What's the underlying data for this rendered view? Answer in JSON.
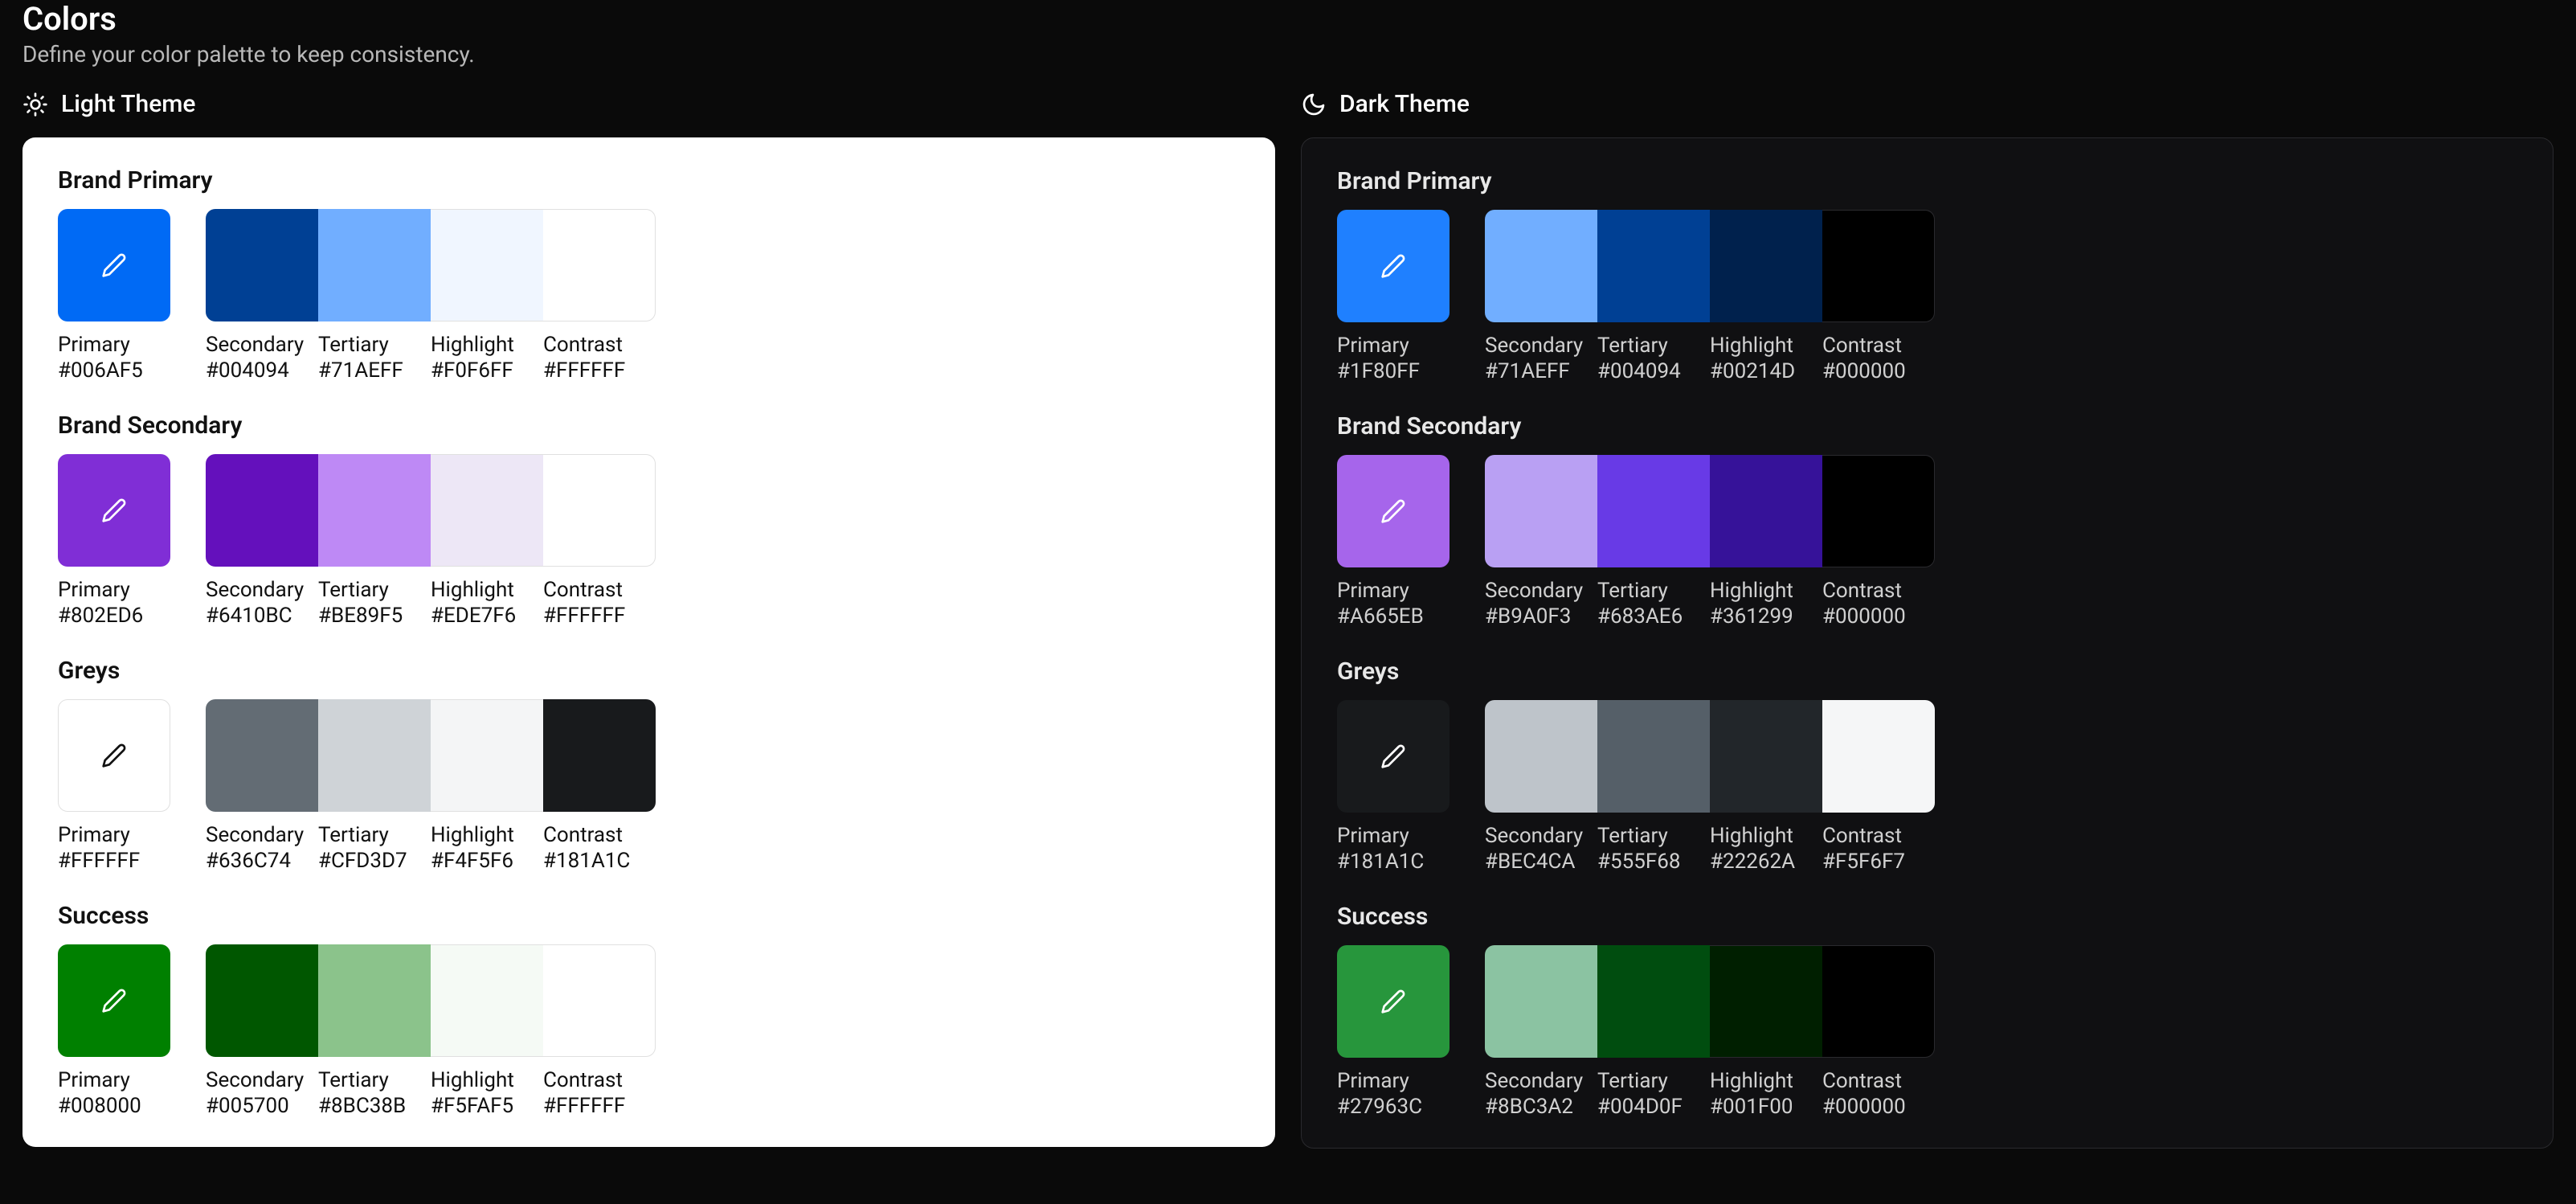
{
  "page": {
    "title": "Colors",
    "subtitle": "Define your color palette to keep consistency."
  },
  "labels": {
    "primary": "Primary",
    "secondary": "Secondary",
    "tertiary": "Tertiary",
    "highlight": "Highlight",
    "contrast": "Contrast"
  },
  "themes": {
    "light": {
      "label": "Light Theme",
      "groups": [
        {
          "title": "Brand Primary",
          "primary_icon_color": "#ffffff",
          "colors": {
            "primary": "#006AF5",
            "secondary": "#004094",
            "tertiary": "#71AEFF",
            "highlight": "#F0F6FF",
            "contrast": "#FFFFFF"
          }
        },
        {
          "title": "Brand Secondary",
          "primary_icon_color": "#ffffff",
          "colors": {
            "primary": "#802ED6",
            "secondary": "#6410BC",
            "tertiary": "#BE89F5",
            "highlight": "#EDE7F6",
            "contrast": "#FFFFFF"
          }
        },
        {
          "title": "Greys",
          "primary_icon_color": "#111111",
          "colors": {
            "primary": "#FFFFFF",
            "secondary": "#636C74",
            "tertiary": "#CFD3D7",
            "highlight": "#F4F5F6",
            "contrast": "#181A1C"
          }
        },
        {
          "title": "Success",
          "primary_icon_color": "#ffffff",
          "colors": {
            "primary": "#008000",
            "secondary": "#005700",
            "tertiary": "#8BC38B",
            "highlight": "#F5FAF5",
            "contrast": "#FFFFFF"
          }
        }
      ]
    },
    "dark": {
      "label": "Dark Theme",
      "groups": [
        {
          "title": "Brand Primary",
          "primary_icon_color": "#ffffff",
          "colors": {
            "primary": "#1F80FF",
            "secondary": "#71AEFF",
            "tertiary": "#004094",
            "highlight": "#00214D",
            "contrast": "#000000"
          }
        },
        {
          "title": "Brand Secondary",
          "primary_icon_color": "#ffffff",
          "colors": {
            "primary": "#A665EB",
            "secondary": "#B9A0F3",
            "tertiary": "#683AE6",
            "highlight": "#361299",
            "contrast": "#000000"
          }
        },
        {
          "title": "Greys",
          "primary_icon_color": "#ffffff",
          "colors": {
            "primary": "#181A1C",
            "secondary": "#BEC4CA",
            "tertiary": "#555F68",
            "highlight": "#22262A",
            "contrast": "#F5F6F7"
          }
        },
        {
          "title": "Success",
          "primary_icon_color": "#ffffff",
          "colors": {
            "primary": "#27963C",
            "secondary": "#8BC3A2",
            "tertiary": "#004D0F",
            "highlight": "#001F00",
            "contrast": "#000000"
          }
        }
      ]
    }
  }
}
